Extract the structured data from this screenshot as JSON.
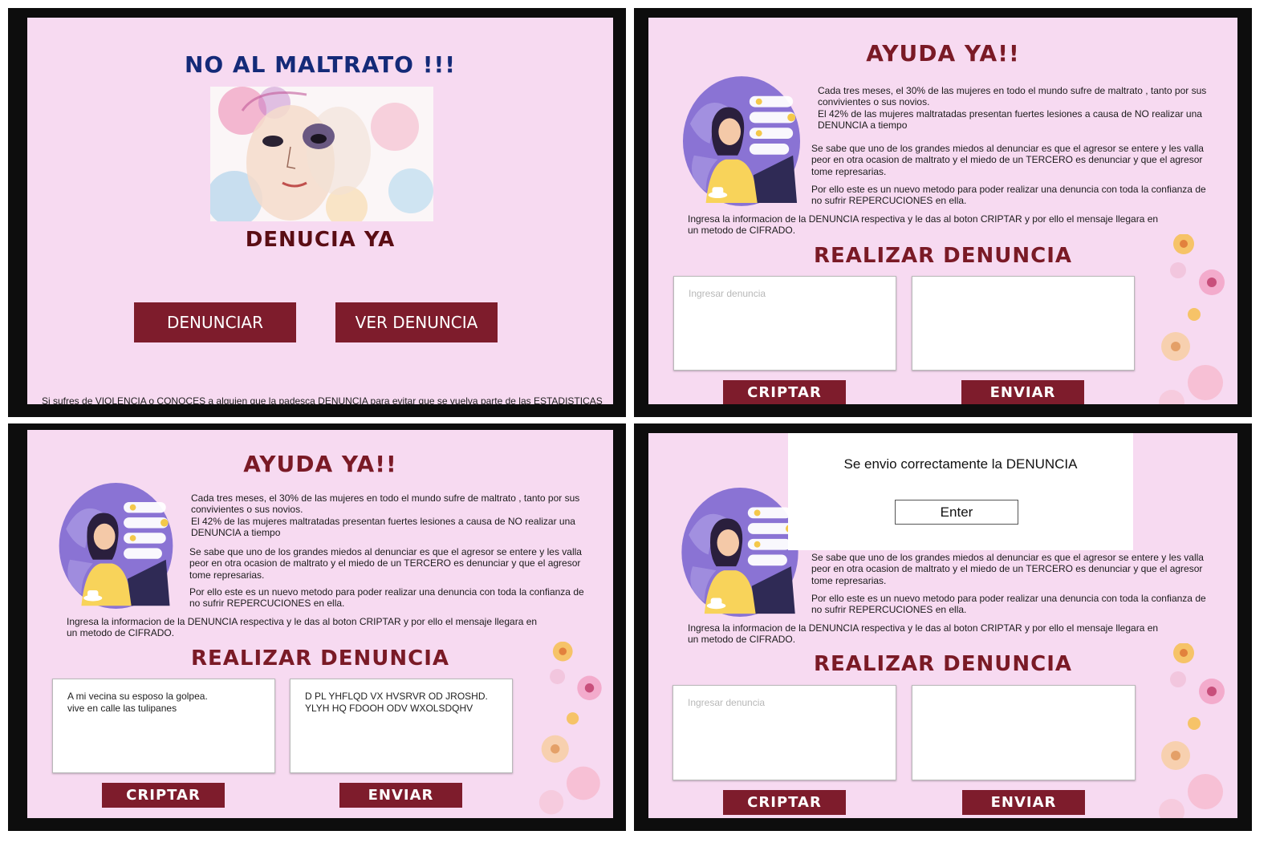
{
  "panel1": {
    "title": "NO AL MALTRATO !!!",
    "subtitle": "DENUCIA YA",
    "btn_denunciar": "DENUNCIAR",
    "btn_ver": "VER DENUNCIA",
    "footer": "Si sufres de VIOLENCIA o CONOCES a alguien  que la padesca DENUNCIA para evitar que se vuelva parte de las ESTADISTICAS"
  },
  "form": {
    "title": "AYUDA  YA!!",
    "p1_l1": "Cada tres meses, el 30% de las mujeres en todo el mundo sufre de maltrato , tanto por sus",
    "p1_l2": "convivientes o sus novios.",
    "p1_l3": "El 42% de las mujeres maltratadas presentan fuertes lesiones a causa de NO realizar una",
    "p1_l4": "DENUNCIA a tiempo",
    "p2_l1": "Se sabe que uno de los grandes miedos al denunciar es que el agresor se entere y les valla",
    "p2_l2": "peor en otra ocasion de maltrato y el miedo de un TERCERO es denunciar y que el agresor",
    "p2_l3": "tome represarias.",
    "p3_l1": "Por ello este es un nuevo metodo para poder realizar una denuncia con toda la confianza de",
    "p3_l2": "no sufrir REPERCUCIONES en ella.",
    "p4_l1": "Ingresa la informacion de la DENUNCIA respectiva y le das al boton CRIPTAR y por ello el mensaje llegara en",
    "p4_l2": "un metodo de CIFRADO.",
    "section_title": "REALIZAR DENUNCIA",
    "placeholder": "Ingresar denuncia",
    "btn_criptar": "CRIPTAR",
    "btn_enviar": "ENVIAR"
  },
  "panel3": {
    "input_value": "A mi vecina su esposo la golpea.\nvive en calle las tulipanes",
    "output_value": "D PL YHFLQD VX HVSRVR OD JROSHD.\nYLYH HQ FDOOH ODV WXOLSDQHV"
  },
  "panel4": {
    "modal_message": "Se envio correctamente la DENUNCIA",
    "modal_button": "Enter"
  },
  "colors": {
    "background": "#f7daf1",
    "button": "#7e1c2c",
    "title_navy": "#142a78",
    "title_maroon": "#5a0d14"
  }
}
